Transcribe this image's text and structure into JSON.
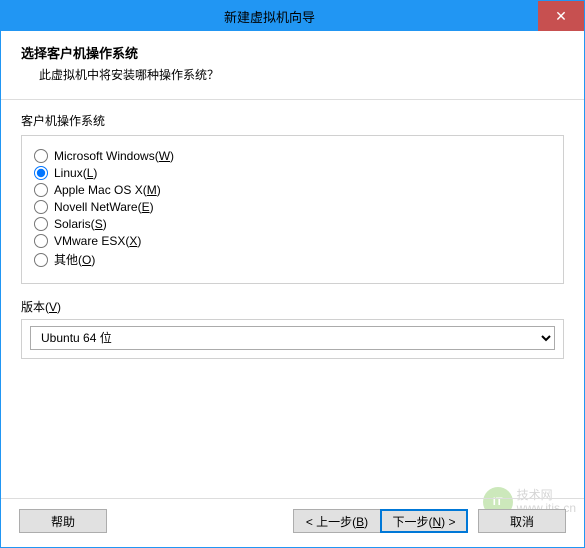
{
  "window": {
    "title": "新建虚拟机向导",
    "close": "✕"
  },
  "header": {
    "title": "选择客户机操作系统",
    "subtitle": "此虚拟机中将安装哪种操作系统？"
  },
  "guest_os": {
    "group_label": "客户机操作系统",
    "options": [
      {
        "label": "Microsoft Windows(",
        "mnemonic": "W",
        "suffix": ")",
        "checked": false
      },
      {
        "label": "Linux(",
        "mnemonic": "L",
        "suffix": ")",
        "checked": true
      },
      {
        "label": "Apple Mac OS X(",
        "mnemonic": "M",
        "suffix": ")",
        "checked": false
      },
      {
        "label": "Novell NetWare(",
        "mnemonic": "E",
        "suffix": ")",
        "checked": false
      },
      {
        "label": "Solaris(",
        "mnemonic": "S",
        "suffix": ")",
        "checked": false
      },
      {
        "label": "VMware ESX(",
        "mnemonic": "X",
        "suffix": ")",
        "checked": false
      },
      {
        "label": "其他(",
        "mnemonic": "O",
        "suffix": ")",
        "checked": false
      }
    ]
  },
  "version": {
    "label_prefix": "版本(",
    "label_mnemonic": "V",
    "label_suffix": ")",
    "selected": "Ubuntu 64 位"
  },
  "footer": {
    "help": "帮助",
    "back_prefix": "< 上一步(",
    "back_mnemonic": "B",
    "back_suffix": ")",
    "next_prefix": "下一步(",
    "next_mnemonic": "N",
    "next_suffix": ") >",
    "cancel": "取消"
  },
  "watermark": {
    "badge": "IT",
    "line1": "技术网",
    "line2": "www.itjs.cn"
  }
}
